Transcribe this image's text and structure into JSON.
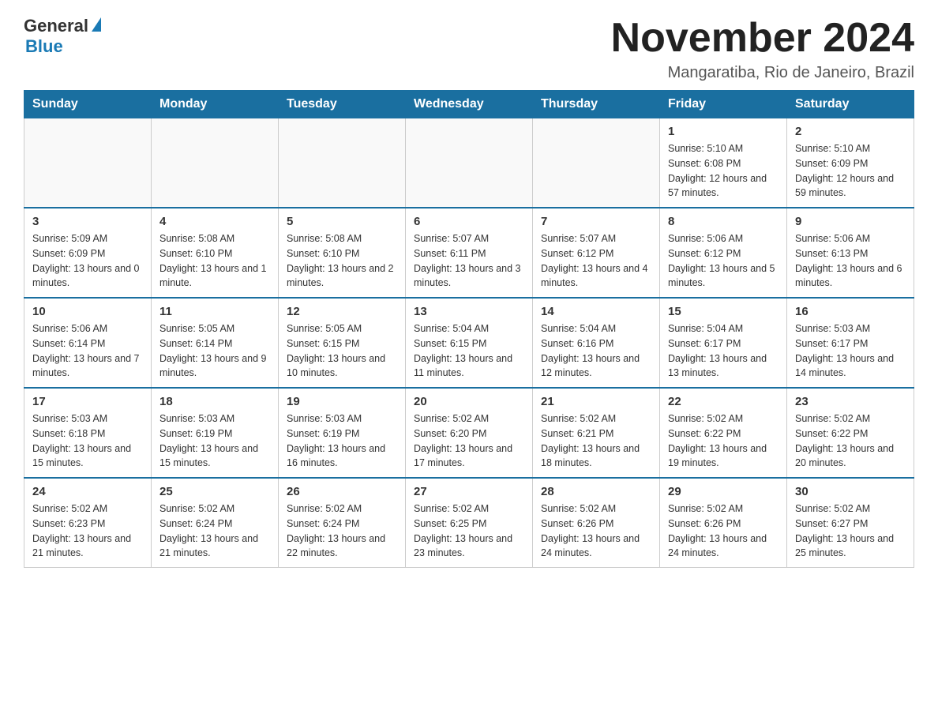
{
  "header": {
    "month_title": "November 2024",
    "location": "Mangaratiba, Rio de Janeiro, Brazil"
  },
  "logo": {
    "general": "General",
    "blue": "Blue"
  },
  "days_of_week": [
    "Sunday",
    "Monday",
    "Tuesday",
    "Wednesday",
    "Thursday",
    "Friday",
    "Saturday"
  ],
  "weeks": [
    [
      {
        "day": "",
        "sunrise": "",
        "sunset": "",
        "daylight": ""
      },
      {
        "day": "",
        "sunrise": "",
        "sunset": "",
        "daylight": ""
      },
      {
        "day": "",
        "sunrise": "",
        "sunset": "",
        "daylight": ""
      },
      {
        "day": "",
        "sunrise": "",
        "sunset": "",
        "daylight": ""
      },
      {
        "day": "",
        "sunrise": "",
        "sunset": "",
        "daylight": ""
      },
      {
        "day": "1",
        "sunrise": "Sunrise: 5:10 AM",
        "sunset": "Sunset: 6:08 PM",
        "daylight": "Daylight: 12 hours and 57 minutes."
      },
      {
        "day": "2",
        "sunrise": "Sunrise: 5:10 AM",
        "sunset": "Sunset: 6:09 PM",
        "daylight": "Daylight: 12 hours and 59 minutes."
      }
    ],
    [
      {
        "day": "3",
        "sunrise": "Sunrise: 5:09 AM",
        "sunset": "Sunset: 6:09 PM",
        "daylight": "Daylight: 13 hours and 0 minutes."
      },
      {
        "day": "4",
        "sunrise": "Sunrise: 5:08 AM",
        "sunset": "Sunset: 6:10 PM",
        "daylight": "Daylight: 13 hours and 1 minute."
      },
      {
        "day": "5",
        "sunrise": "Sunrise: 5:08 AM",
        "sunset": "Sunset: 6:10 PM",
        "daylight": "Daylight: 13 hours and 2 minutes."
      },
      {
        "day": "6",
        "sunrise": "Sunrise: 5:07 AM",
        "sunset": "Sunset: 6:11 PM",
        "daylight": "Daylight: 13 hours and 3 minutes."
      },
      {
        "day": "7",
        "sunrise": "Sunrise: 5:07 AM",
        "sunset": "Sunset: 6:12 PM",
        "daylight": "Daylight: 13 hours and 4 minutes."
      },
      {
        "day": "8",
        "sunrise": "Sunrise: 5:06 AM",
        "sunset": "Sunset: 6:12 PM",
        "daylight": "Daylight: 13 hours and 5 minutes."
      },
      {
        "day": "9",
        "sunrise": "Sunrise: 5:06 AM",
        "sunset": "Sunset: 6:13 PM",
        "daylight": "Daylight: 13 hours and 6 minutes."
      }
    ],
    [
      {
        "day": "10",
        "sunrise": "Sunrise: 5:06 AM",
        "sunset": "Sunset: 6:14 PM",
        "daylight": "Daylight: 13 hours and 7 minutes."
      },
      {
        "day": "11",
        "sunrise": "Sunrise: 5:05 AM",
        "sunset": "Sunset: 6:14 PM",
        "daylight": "Daylight: 13 hours and 9 minutes."
      },
      {
        "day": "12",
        "sunrise": "Sunrise: 5:05 AM",
        "sunset": "Sunset: 6:15 PM",
        "daylight": "Daylight: 13 hours and 10 minutes."
      },
      {
        "day": "13",
        "sunrise": "Sunrise: 5:04 AM",
        "sunset": "Sunset: 6:15 PM",
        "daylight": "Daylight: 13 hours and 11 minutes."
      },
      {
        "day": "14",
        "sunrise": "Sunrise: 5:04 AM",
        "sunset": "Sunset: 6:16 PM",
        "daylight": "Daylight: 13 hours and 12 minutes."
      },
      {
        "day": "15",
        "sunrise": "Sunrise: 5:04 AM",
        "sunset": "Sunset: 6:17 PM",
        "daylight": "Daylight: 13 hours and 13 minutes."
      },
      {
        "day": "16",
        "sunrise": "Sunrise: 5:03 AM",
        "sunset": "Sunset: 6:17 PM",
        "daylight": "Daylight: 13 hours and 14 minutes."
      }
    ],
    [
      {
        "day": "17",
        "sunrise": "Sunrise: 5:03 AM",
        "sunset": "Sunset: 6:18 PM",
        "daylight": "Daylight: 13 hours and 15 minutes."
      },
      {
        "day": "18",
        "sunrise": "Sunrise: 5:03 AM",
        "sunset": "Sunset: 6:19 PM",
        "daylight": "Daylight: 13 hours and 15 minutes."
      },
      {
        "day": "19",
        "sunrise": "Sunrise: 5:03 AM",
        "sunset": "Sunset: 6:19 PM",
        "daylight": "Daylight: 13 hours and 16 minutes."
      },
      {
        "day": "20",
        "sunrise": "Sunrise: 5:02 AM",
        "sunset": "Sunset: 6:20 PM",
        "daylight": "Daylight: 13 hours and 17 minutes."
      },
      {
        "day": "21",
        "sunrise": "Sunrise: 5:02 AM",
        "sunset": "Sunset: 6:21 PM",
        "daylight": "Daylight: 13 hours and 18 minutes."
      },
      {
        "day": "22",
        "sunrise": "Sunrise: 5:02 AM",
        "sunset": "Sunset: 6:22 PM",
        "daylight": "Daylight: 13 hours and 19 minutes."
      },
      {
        "day": "23",
        "sunrise": "Sunrise: 5:02 AM",
        "sunset": "Sunset: 6:22 PM",
        "daylight": "Daylight: 13 hours and 20 minutes."
      }
    ],
    [
      {
        "day": "24",
        "sunrise": "Sunrise: 5:02 AM",
        "sunset": "Sunset: 6:23 PM",
        "daylight": "Daylight: 13 hours and 21 minutes."
      },
      {
        "day": "25",
        "sunrise": "Sunrise: 5:02 AM",
        "sunset": "Sunset: 6:24 PM",
        "daylight": "Daylight: 13 hours and 21 minutes."
      },
      {
        "day": "26",
        "sunrise": "Sunrise: 5:02 AM",
        "sunset": "Sunset: 6:24 PM",
        "daylight": "Daylight: 13 hours and 22 minutes."
      },
      {
        "day": "27",
        "sunrise": "Sunrise: 5:02 AM",
        "sunset": "Sunset: 6:25 PM",
        "daylight": "Daylight: 13 hours and 23 minutes."
      },
      {
        "day": "28",
        "sunrise": "Sunrise: 5:02 AM",
        "sunset": "Sunset: 6:26 PM",
        "daylight": "Daylight: 13 hours and 24 minutes."
      },
      {
        "day": "29",
        "sunrise": "Sunrise: 5:02 AM",
        "sunset": "Sunset: 6:26 PM",
        "daylight": "Daylight: 13 hours and 24 minutes."
      },
      {
        "day": "30",
        "sunrise": "Sunrise: 5:02 AM",
        "sunset": "Sunset: 6:27 PM",
        "daylight": "Daylight: 13 hours and 25 minutes."
      }
    ]
  ]
}
